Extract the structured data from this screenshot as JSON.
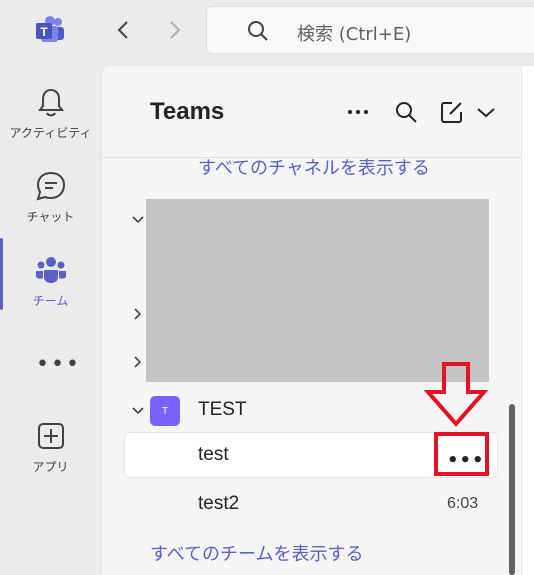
{
  "titlebar": {
    "search_placeholder": "検索 (Ctrl+E)"
  },
  "rail": {
    "items": [
      {
        "label": "アクティビティ",
        "icon": "bell-icon"
      },
      {
        "label": "チャット",
        "icon": "chat-icon"
      },
      {
        "label": "チーム",
        "icon": "teams-icon",
        "active": true
      },
      {
        "label": "アプリ",
        "icon": "apps-icon"
      }
    ],
    "more_label": "•••"
  },
  "panel": {
    "title": "Teams",
    "show_all_channels": "すべてのチャネルを表示する",
    "show_all_teams": "すべてのチームを表示する",
    "team": {
      "avatar_text": "T",
      "name": "TEST",
      "channels": [
        {
          "name": "test",
          "more": "•••"
        },
        {
          "name": "test2",
          "time": "6:03"
        }
      ]
    }
  },
  "colors": {
    "accent": "#5b5fc7",
    "annotation": "#e81123",
    "redacted": "#c4c4c4"
  }
}
